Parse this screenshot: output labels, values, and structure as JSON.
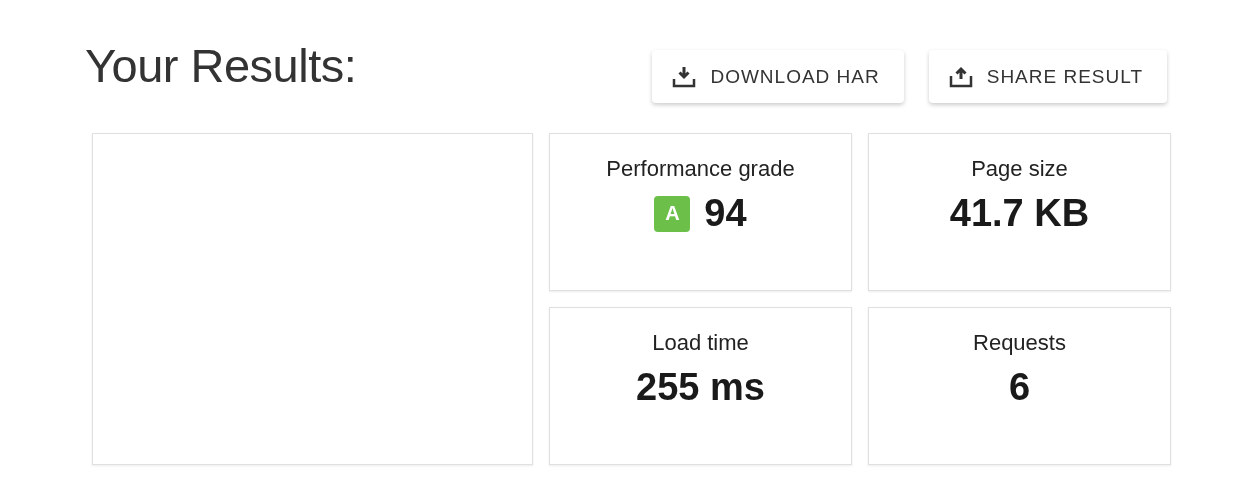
{
  "title": "Your Results:",
  "buttons": [
    {
      "label": "DOWNLOAD HAR",
      "kind": "download"
    },
    {
      "label": "SHARE RESULT",
      "kind": "share"
    }
  ],
  "metrics": [
    {
      "label": "Performance grade",
      "value": "94",
      "kind": "grade",
      "grade": "A"
    },
    {
      "label": "Page size",
      "value": "41.7 KB",
      "kind": "plain"
    },
    {
      "label": "Load time",
      "value": "255 ms",
      "kind": "plain"
    },
    {
      "label": "Requests",
      "value": "6",
      "kind": "plain"
    }
  ]
}
